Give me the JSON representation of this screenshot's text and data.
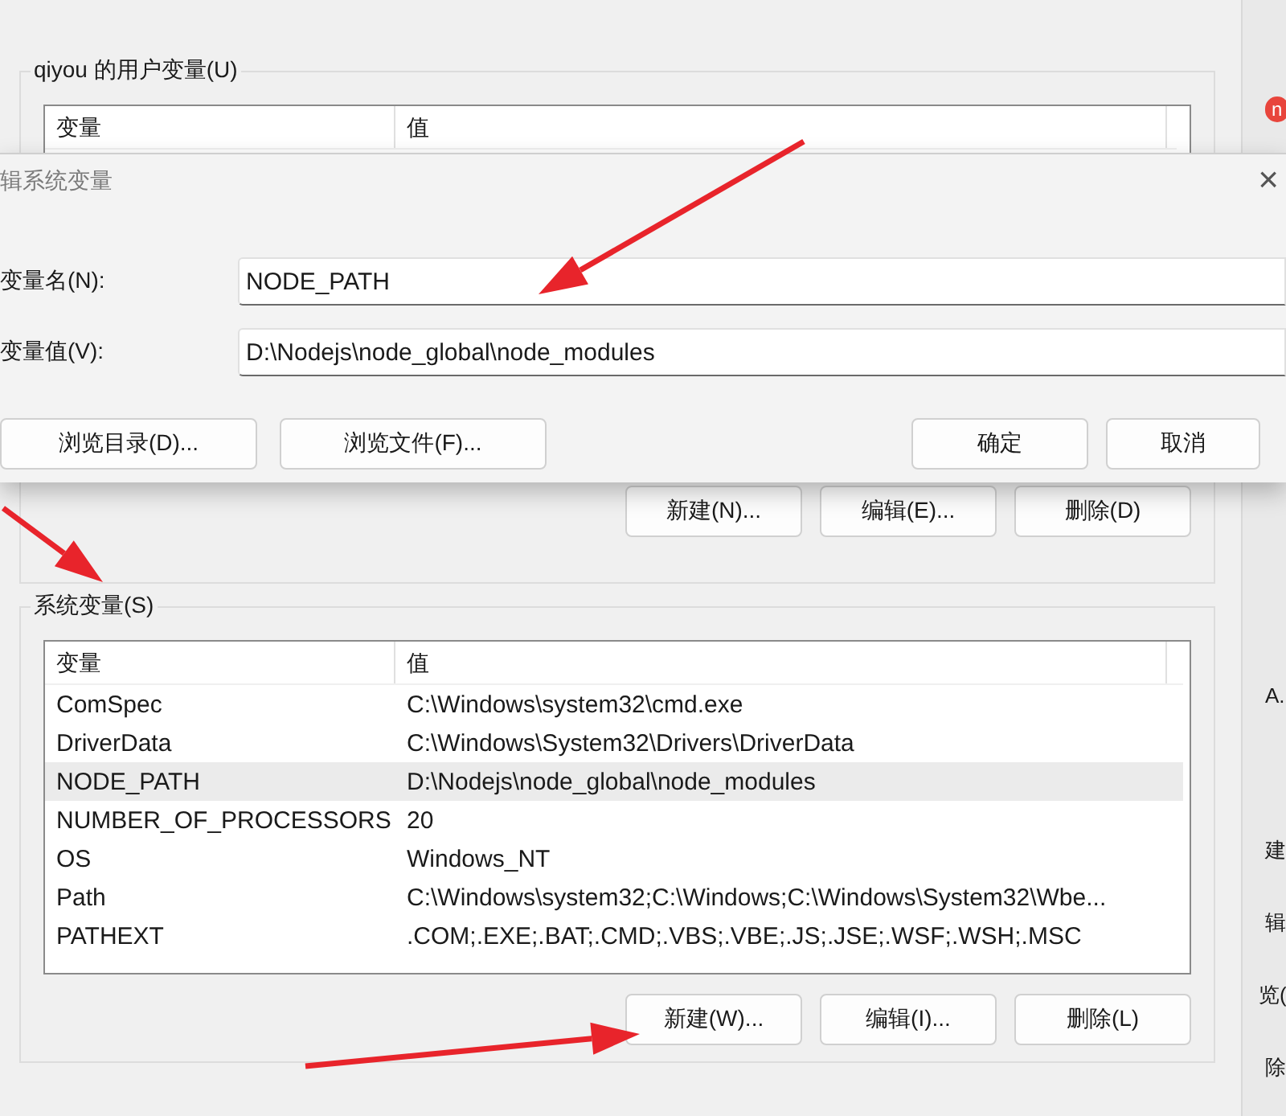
{
  "user_vars": {
    "title": "qiyou 的用户变量(U)",
    "columns": [
      "变量",
      "值"
    ],
    "buttons": [
      "新建(N)...",
      "编辑(E)...",
      "删除(D)"
    ]
  },
  "system_vars": {
    "title": "系统变量(S)",
    "columns": [
      "变量",
      "值"
    ],
    "rows": [
      {
        "name": "ComSpec",
        "value": "C:\\Windows\\system32\\cmd.exe",
        "selected": false
      },
      {
        "name": "DriverData",
        "value": "C:\\Windows\\System32\\Drivers\\DriverData",
        "selected": false
      },
      {
        "name": "NODE_PATH",
        "value": "D:\\Nodejs\\node_global\\node_modules",
        "selected": true
      },
      {
        "name": "NUMBER_OF_PROCESSORS",
        "value": "20",
        "selected": false
      },
      {
        "name": "OS",
        "value": "Windows_NT",
        "selected": false
      },
      {
        "name": "Path",
        "value": "C:\\Windows\\system32;C:\\Windows;C:\\Windows\\System32\\Wbe...",
        "selected": false
      },
      {
        "name": "PATHEXT",
        "value": ".COM;.EXE;.BAT;.CMD;.VBS;.VBE;.JS;.JSE;.WSF;.WSH;.MSC",
        "selected": false
      }
    ],
    "buttons": [
      "新建(W)...",
      "编辑(I)...",
      "删除(L)"
    ]
  },
  "side_window": {
    "badge": "n",
    "fragments": [
      "A.",
      "建",
      "辑",
      "览(",
      "除"
    ]
  },
  "dialog": {
    "title": "辑系统变量",
    "close": "×",
    "fields": [
      {
        "label": "变量名(N):",
        "value": "NODE_PATH"
      },
      {
        "label": "变量值(V):",
        "value": "D:\\Nodejs\\node_global\\node_modules"
      }
    ],
    "left_buttons": [
      "浏览目录(D)...",
      "浏览文件(F)..."
    ],
    "right_buttons": [
      "确定",
      "取消"
    ]
  }
}
